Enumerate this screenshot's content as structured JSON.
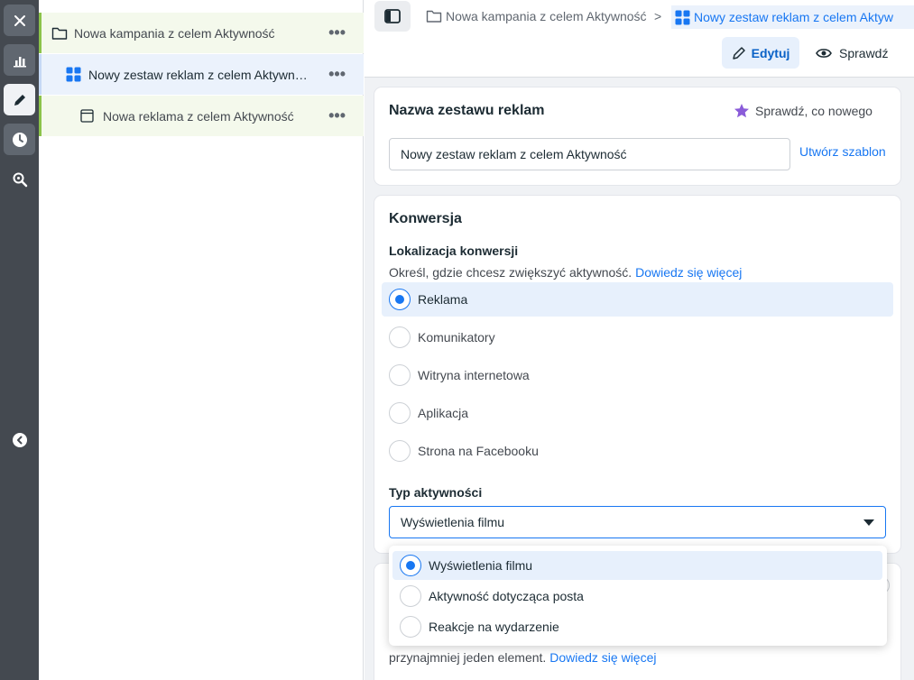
{
  "tree": {
    "campaign": "Nowa kampania z celem Aktywność",
    "adset": "Nowy zestaw reklam z celem Aktywność",
    "ad": "Nowa reklama z celem Aktywność"
  },
  "breadcrumb": {
    "campaign": "Nowa kampania z celem Aktywność",
    "separator": ">",
    "adset": "Nowy zestaw reklam z celem Aktyw"
  },
  "toolbar": {
    "edit_label": "Edytuj",
    "review_label": "Sprawdź"
  },
  "adset_name_card": {
    "title": "Nazwa zestawu reklam",
    "whats_new": "Sprawdź, co nowego",
    "name_value": "Nowy zestaw reklam z celem Aktywność",
    "create_template": "Utwórz szablon"
  },
  "conversion": {
    "title": "Konwersja",
    "location_label": "Lokalizacja konwersji",
    "help_text": "Określ, gdzie chcesz zwiększyć aktywność.",
    "help_link": "Dowiedz się więcej",
    "options": [
      "Reklama",
      "Komunikatory",
      "Witryna internetowa",
      "Aplikacja",
      "Strona na Facebooku"
    ],
    "selected": "Reklama",
    "activity_type_label": "Typ aktywności",
    "activity_type_value": "Wyświetlenia filmu"
  },
  "dropdown": {
    "options": [
      "Wyświetlenia filmu",
      "Aktywność dotycząca posta",
      "Reakcje na wydarzenie"
    ],
    "selected": "Wyświetlenia filmu"
  },
  "next_card": {
    "text": "przynajmniej jeden element.",
    "link": "Dowiedz się więcej"
  },
  "colors": {
    "accent": "#1877f2",
    "rail": "#444950",
    "campaign_highlight": "#8bc34a",
    "selected_bg": "#e7f0fc"
  }
}
